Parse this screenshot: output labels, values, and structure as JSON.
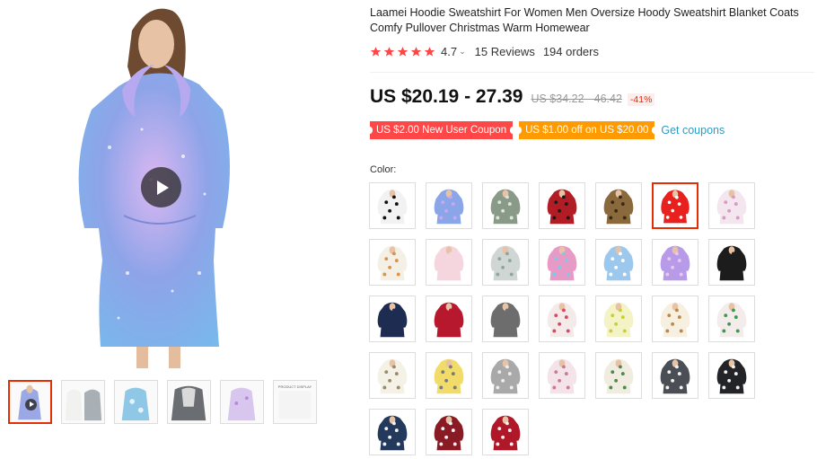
{
  "product": {
    "title": "Laamei Hoodie Sweatshirt For Women Men Oversize Hoody Sweatshirt Blanket Coats Comfy Pullover Christmas Warm Homewear",
    "rating": "4.7",
    "rating_chevron": "⌄",
    "reviews": "15 Reviews",
    "orders": "194 orders",
    "price": "US $20.19 - 27.39",
    "original_price": "US $34.22 - 46.42",
    "discount": "-41%",
    "stars_filled": 5,
    "star_color": "#ff4747"
  },
  "coupons": {
    "new_user": "US $2.00 New User Coupon",
    "store": "US $1.00 off on US $20.00",
    "get_link": "Get coupons"
  },
  "colors": {
    "label": "Color:",
    "selected_index": 5,
    "accent": "#e62e04",
    "swatches": [
      {
        "name": "cow print",
        "fill": "#f2f2f2",
        "pattern": "#111111"
      },
      {
        "name": "galaxy",
        "fill": "#8aa6e8",
        "pattern": "#c9a8ef"
      },
      {
        "name": "camouflage",
        "fill": "#8a9a88",
        "pattern": "#dfe4dc"
      },
      {
        "name": "red plaid",
        "fill": "#b21d25",
        "pattern": "#1a1a1a"
      },
      {
        "name": "leopard",
        "fill": "#8a6a3d",
        "pattern": "#3a2a14"
      },
      {
        "name": "red polka",
        "fill": "#e8201e",
        "pattern": "#ffffff"
      },
      {
        "name": "pink floral",
        "fill": "#f4e6ee",
        "pattern": "#d89ac2"
      },
      {
        "name": "avocado",
        "fill": "#f4f0e6",
        "pattern": "#d7954a"
      },
      {
        "name": "pink",
        "fill": "#f6d6de",
        "pattern": "#f6d6de"
      },
      {
        "name": "grey print",
        "fill": "#cfd6d3",
        "pattern": "#8fa79c"
      },
      {
        "name": "tie dye",
        "fill": "#e89ac6",
        "pattern": "#7fc9e8"
      },
      {
        "name": "sky clouds",
        "fill": "#9cc8ee",
        "pattern": "#ffffff"
      },
      {
        "name": "purple galaxy",
        "fill": "#b79be8",
        "pattern": "#e9c6f4"
      },
      {
        "name": "black",
        "fill": "#1c1c1c",
        "pattern": "#1c1c1c"
      },
      {
        "name": "navy",
        "fill": "#1f2c52",
        "pattern": "#1f2c52"
      },
      {
        "name": "wine red",
        "fill": "#b8182e",
        "pattern": "#b8182e"
      },
      {
        "name": "dark grey",
        "fill": "#6d6d6d",
        "pattern": "#6d6d6d"
      },
      {
        "name": "strawberry",
        "fill": "#f5eaea",
        "pattern": "#d84860"
      },
      {
        "name": "lemon",
        "fill": "#f3f3c6",
        "pattern": "#c8cf38"
      },
      {
        "name": "cookies",
        "fill": "#f7f0e0",
        "pattern": "#b88a4a"
      },
      {
        "name": "watermelon",
        "fill": "#f3ecea",
        "pattern": "#3a9a4a"
      },
      {
        "name": "cream floral",
        "fill": "#f4f1e6",
        "pattern": "#9a8a6a"
      },
      {
        "name": "yellow duck",
        "fill": "#f1dc6a",
        "pattern": "#7a7a7a"
      },
      {
        "name": "grey print",
        "fill": "#a9a9a9",
        "pattern": "#eeeeee"
      },
      {
        "name": "pink cats",
        "fill": "#f4e4ea",
        "pattern": "#c97a96"
      },
      {
        "name": "cactus",
        "fill": "#f1ece0",
        "pattern": "#4a8a4a"
      },
      {
        "name": "charcoal sherpa",
        "fill": "#4a4e55",
        "pattern": "#f3f3f3"
      },
      {
        "name": "black sherpa",
        "fill": "#222428",
        "pattern": "#f3f3f3"
      },
      {
        "name": "navy sherpa",
        "fill": "#233a5c",
        "pattern": "#f3f3f3"
      },
      {
        "name": "burgundy plaid",
        "fill": "#8a1a24",
        "pattern": "#f3f3f3"
      },
      {
        "name": "red sherpa",
        "fill": "#b0182a",
        "pattern": "#f3f3f3"
      }
    ]
  },
  "gallery": {
    "thumbs": [
      {
        "fill": "#9aa8e6",
        "pattern": "#d0a6ee"
      },
      {
        "fill": "#e2e2e0",
        "pattern": "#cfcfcf"
      },
      {
        "fill": "#8ec8e6",
        "pattern": "#d8eef8"
      },
      {
        "fill": "#6a6d72",
        "pattern": "#dadada"
      },
      {
        "fill": "#d9c6ee",
        "pattern": "#f2e8fa"
      },
      {
        "fill": "#f4f4f4",
        "pattern": "#ffffff"
      }
    ],
    "size_label": "PRODUCT DISPLAY",
    "active_index": 0
  }
}
